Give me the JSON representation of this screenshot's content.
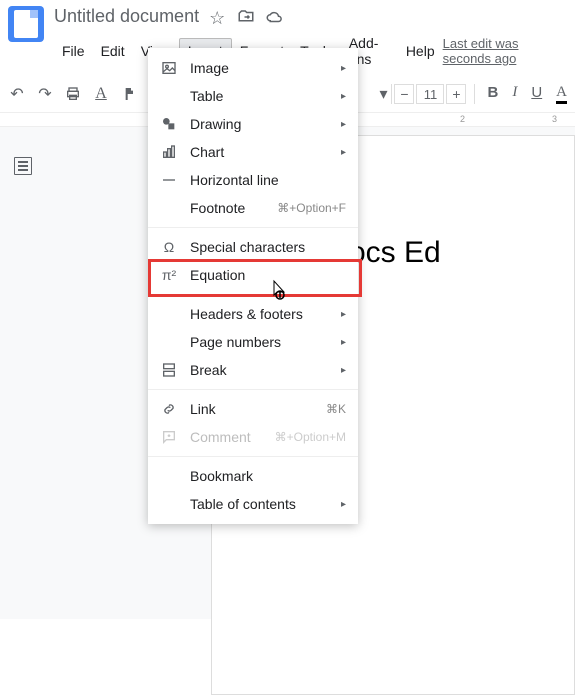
{
  "doc": {
    "title": "Untitled document"
  },
  "menubar": {
    "file": "File",
    "edit": "Edit",
    "view": "View",
    "insert": "Insert",
    "format": "Format",
    "tools": "Tools",
    "addons": "Add-ons",
    "help": "Help",
    "last_edit": "Last edit was seconds ago"
  },
  "toolbar": {
    "font_size": "11"
  },
  "ruler": {
    "m2": "2",
    "m3": "3"
  },
  "page": {
    "content": "Google Docs Ed"
  },
  "insert_menu": {
    "image": "Image",
    "table": "Table",
    "drawing": "Drawing",
    "chart": "Chart",
    "hr": "Horizontal line",
    "footnote": "Footnote",
    "footnote_key": "⌘+Option+F",
    "special": "Special characters",
    "equation": "Equation",
    "headers": "Headers & footers",
    "pagenum": "Page numbers",
    "break": "Break",
    "link": "Link",
    "link_key": "⌘K",
    "comment": "Comment",
    "comment_key": "⌘+Option+M",
    "bookmark": "Bookmark",
    "toc": "Table of contents"
  }
}
